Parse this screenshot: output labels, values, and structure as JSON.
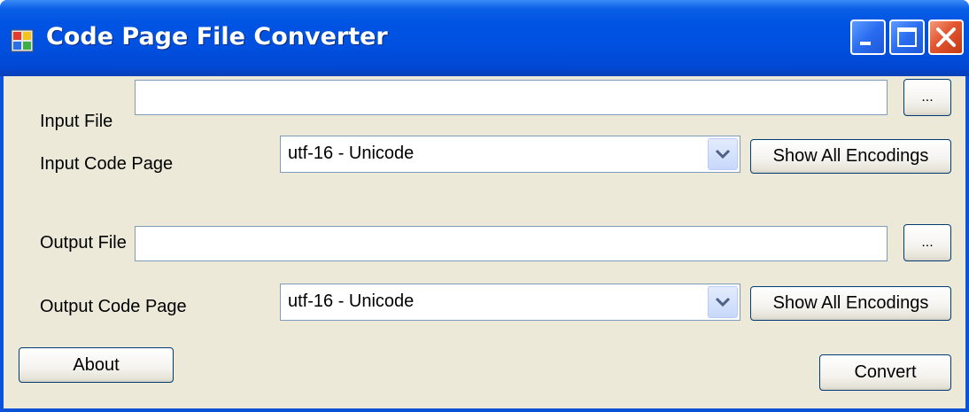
{
  "window": {
    "title": "Code Page File Converter"
  },
  "input_file": {
    "label": "Input File",
    "value": "",
    "browse_label": "..."
  },
  "input_code_page": {
    "label": "Input Code Page",
    "selected": "utf-16 - Unicode",
    "show_all_label": "Show All Encodings"
  },
  "output_file": {
    "label": "Output File",
    "value": "",
    "browse_label": "..."
  },
  "output_code_page": {
    "label": "Output Code Page",
    "selected": "utf-16 - Unicode",
    "show_all_label": "Show All Encodings"
  },
  "actions": {
    "about_label": "About",
    "convert_label": "Convert"
  },
  "icons": [
    "app-icon",
    "minimize-icon",
    "maximize-icon",
    "close-icon",
    "chevron-down-icon"
  ],
  "colors": {
    "titlebar": "#0054e3",
    "window_bg": "#ece9d8",
    "border": "#0a53d8",
    "close": "#e2552e"
  }
}
